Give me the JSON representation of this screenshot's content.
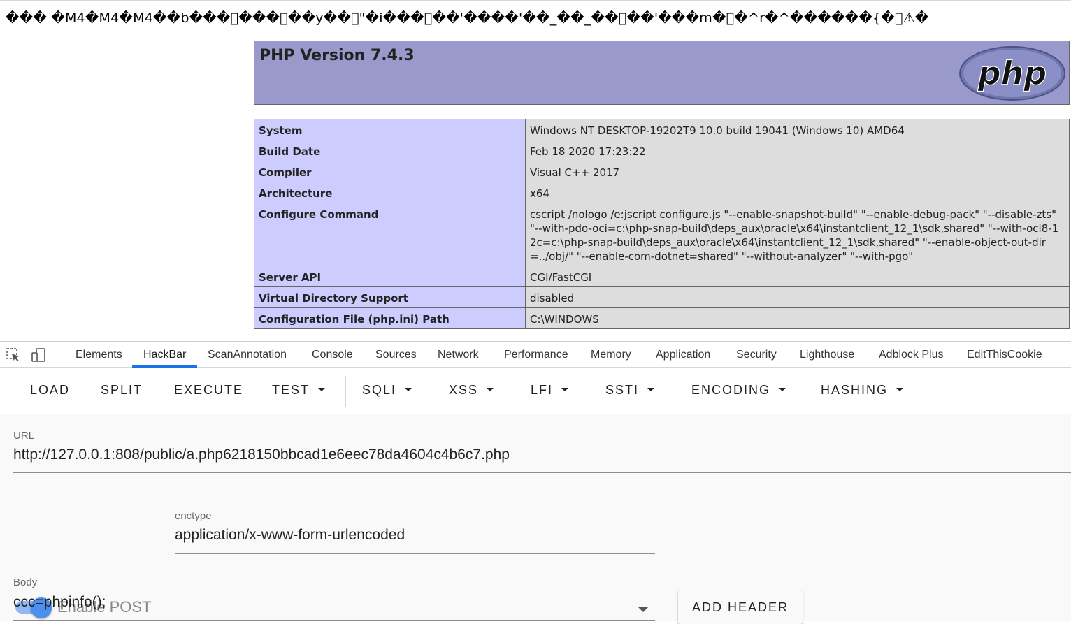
{
  "page": {
    "garbled_text": "��� �M4�M4�M4��b���\u0000���\u0000��y��\u0000\"�i���\u0000��'����'��_��_��\u0000��'���m�\u0000�^r�^������{�\u0000⚠�",
    "php_header": {
      "title": "PHP Version 7.4.3",
      "logo_text": "php"
    },
    "info_rows": [
      {
        "key": "System",
        "value": "Windows NT DESKTOP-19202T9 10.0 build 19041 (Windows 10) AMD64"
      },
      {
        "key": "Build Date",
        "value": "Feb 18 2020 17:23:22"
      },
      {
        "key": "Compiler",
        "value": "Visual C++ 2017"
      },
      {
        "key": "Architecture",
        "value": "x64"
      },
      {
        "key": "Configure Command",
        "value": "cscript /nologo /e:jscript configure.js \"--enable-snapshot-build\" \"--enable-debug-pack\" \"--disable-zts\" \"--with-pdo-oci=c:\\php-snap-build\\deps_aux\\oracle\\x64\\instantclient_12_1\\sdk,shared\" \"--with-oci8-12c=c:\\php-snap-build\\deps_aux\\oracle\\x64\\instantclient_12_1\\sdk,shared\" \"--enable-object-out-dir=../obj/\" \"--enable-com-dotnet=shared\" \"--without-analyzer\" \"--with-pgo\""
      },
      {
        "key": "Server API",
        "value": "CGI/FastCGI"
      },
      {
        "key": "Virtual Directory Support",
        "value": "disabled"
      },
      {
        "key": "Configuration File (php.ini) Path",
        "value": "C:\\WINDOWS"
      }
    ]
  },
  "devtools": {
    "icons": [
      "inspect-element-icon",
      "device-toggle-icon"
    ],
    "tabs": [
      {
        "label": "Elements",
        "active": false
      },
      {
        "label": "HackBar",
        "active": true
      },
      {
        "label": "ScanAnnotation",
        "active": false
      },
      {
        "label": "Console",
        "active": false
      },
      {
        "label": "Sources",
        "active": false
      },
      {
        "label": "Network",
        "active": false
      },
      {
        "label": "Performance",
        "active": false
      },
      {
        "label": "Memory",
        "active": false
      },
      {
        "label": "Application",
        "active": false
      },
      {
        "label": "Security",
        "active": false
      },
      {
        "label": "Lighthouse",
        "active": false
      },
      {
        "label": "Adblock Plus",
        "active": false
      },
      {
        "label": "EditThisCookie",
        "active": false
      }
    ],
    "accent_color": "#1a73e8"
  },
  "hackbar": {
    "toolbar": {
      "load": "LOAD",
      "split": "SPLIT",
      "execute": "EXECUTE",
      "test": "TEST",
      "sqli": "SQLI",
      "xss": "XSS",
      "lfi": "LFI",
      "ssti": "SSTI",
      "encoding": "ENCODING",
      "hashing": "HASHING"
    },
    "url": {
      "label": "URL",
      "value": "http://127.0.0.1:808/public/a.php6218150bbcad1e6eec78da4604c4b6c7.php"
    },
    "enable_post": {
      "label": "Enable POST",
      "checked": true
    },
    "enctype": {
      "label": "enctype",
      "value": "application/x-www-form-urlencoded"
    },
    "add_header": "ADD HEADER",
    "body": {
      "label": "Body",
      "value": "ccc=phpinfo();"
    }
  }
}
